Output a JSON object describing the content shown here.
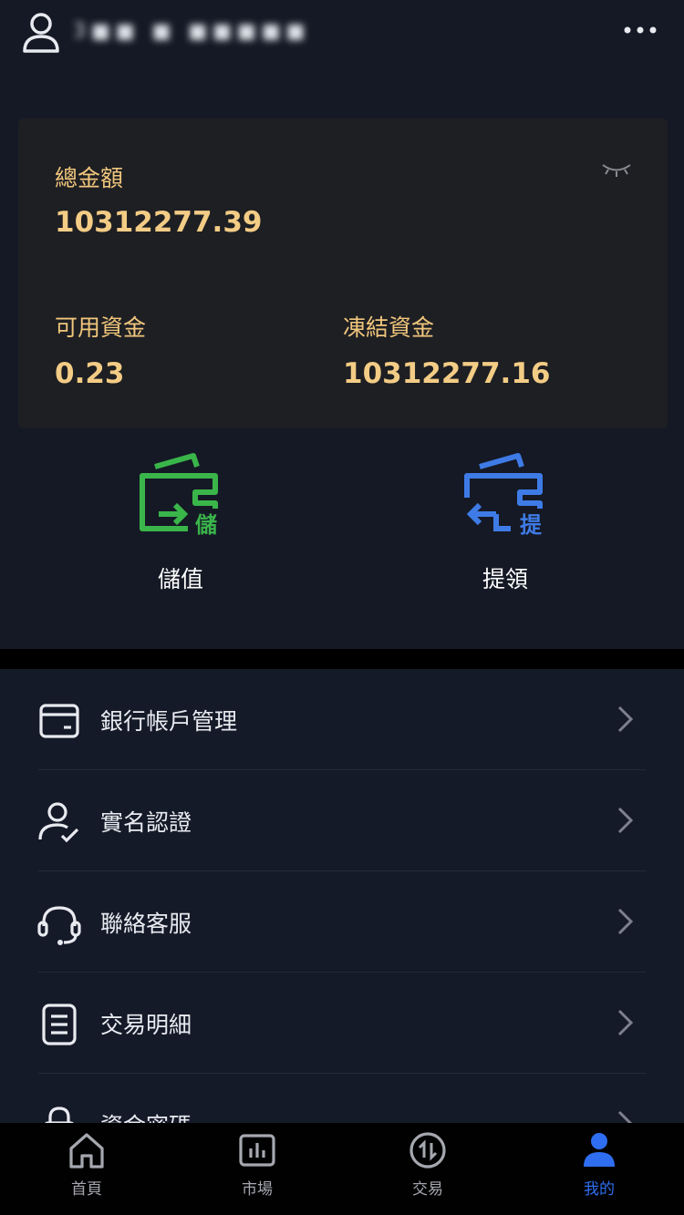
{
  "header": {
    "username": "3■■ ■ ■■■■■",
    "more_icon": "more-horizontal-icon"
  },
  "assets": {
    "total_label": "總金額",
    "total_value": "10312277.39",
    "available_label": "可用資金",
    "available_value": "0.23",
    "frozen_label": "凍結資金",
    "frozen_value": "10312277.16",
    "visibility_icon": "eye-closed-icon"
  },
  "actions": [
    {
      "label": "儲值",
      "badge": "儲",
      "icon": "deposit-wallet-icon",
      "color": "#3ab54a"
    },
    {
      "label": "提領",
      "badge": "提",
      "icon": "withdraw-wallet-icon",
      "color": "#3e7be6"
    }
  ],
  "menu": [
    {
      "label": "銀行帳戶管理",
      "icon": "bank-card-icon"
    },
    {
      "label": "實名認證",
      "icon": "user-verified-icon"
    },
    {
      "label": "聯絡客服",
      "icon": "headset-icon"
    },
    {
      "label": "交易明細",
      "icon": "document-list-icon"
    },
    {
      "label": "資金密碼",
      "icon": "lock-icon"
    }
  ],
  "nav": [
    {
      "label": "首頁",
      "icon": "home-icon",
      "active": false
    },
    {
      "label": "市場",
      "icon": "chart-icon",
      "active": false
    },
    {
      "label": "交易",
      "icon": "exchange-icon",
      "active": false
    },
    {
      "label": "我的",
      "icon": "profile-icon",
      "active": true
    }
  ],
  "colors": {
    "background": "#151925",
    "gold": "#f3cc85",
    "active_blue": "#2f6ef0",
    "deposit_green": "#3ab54a",
    "withdraw_blue": "#3e7be6"
  }
}
